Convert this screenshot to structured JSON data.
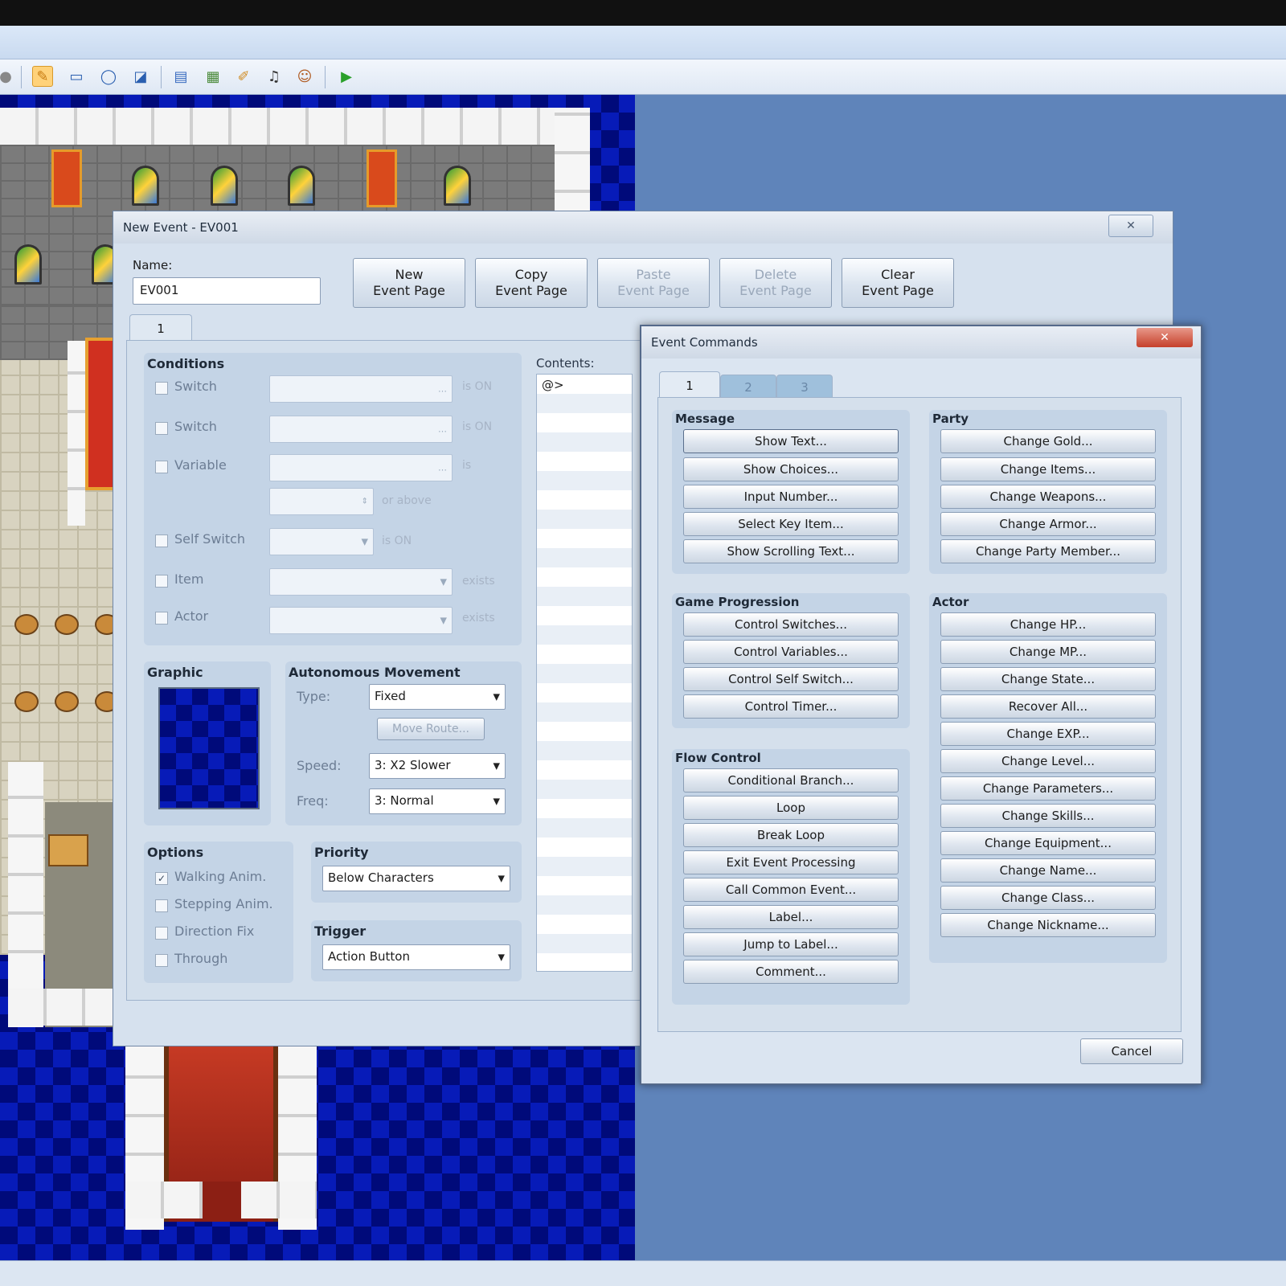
{
  "toolbar": {
    "icons": [
      "pencil-tool-icon",
      "rectangle-tool-icon",
      "ellipse-tool-icon",
      "fill-tool-icon",
      "shadow-pen-icon",
      "database-icon",
      "resource-manager-icon",
      "script-editor-icon",
      "sound-test-icon",
      "character-generator-icon",
      "playtest-icon"
    ]
  },
  "event_editor": {
    "title": "New Event - EV001",
    "close_glyph": "✕",
    "name_label": "Name:",
    "name_value": "EV001",
    "buttons": {
      "new_page_1": "New",
      "new_page_2": "Event Page",
      "copy_page_1": "Copy",
      "copy_page_2": "Event Page",
      "paste_page_1": "Paste",
      "paste_page_2": "Event Page",
      "delete_page_1": "Delete",
      "delete_page_2": "Event Page",
      "clear_page_1": "Clear",
      "clear_page_2": "Event Page"
    },
    "page_tab": "1",
    "conditions": {
      "label": "Conditions",
      "switch1": "Switch",
      "switch1_suffix": "is ON",
      "switch2": "Switch",
      "switch2_suffix": "is ON",
      "variable": "Variable",
      "variable_suffix": "is",
      "variable_above": "or above",
      "self_switch": "Self Switch",
      "self_switch_suffix": "is ON",
      "item": "Item",
      "item_suffix": "exists",
      "actor": "Actor",
      "actor_suffix": "exists"
    },
    "contents": {
      "label": "Contents:",
      "first_line": "@>"
    },
    "graphic": {
      "label": "Graphic"
    },
    "movement": {
      "label": "Autonomous Movement",
      "type_label": "Type:",
      "type_value": "Fixed",
      "move_route_button": "Move Route...",
      "speed_label": "Speed:",
      "speed_value": "3: X2 Slower",
      "freq_label": "Freq:",
      "freq_value": "3: Normal"
    },
    "options": {
      "label": "Options",
      "walking": "Walking Anim.",
      "stepping": "Stepping Anim.",
      "direction_fix": "Direction Fix",
      "through": "Through",
      "walking_checked": "✓"
    },
    "priority": {
      "label": "Priority",
      "value": "Below Characters"
    },
    "trigger": {
      "label": "Trigger",
      "value": "Action Button"
    }
  },
  "event_commands": {
    "title": "Event Commands",
    "close_glyph": "✕",
    "tabs": [
      "1",
      "2",
      "3"
    ],
    "message": {
      "label": "Message",
      "items": [
        "Show Text...",
        "Show Choices...",
        "Input Number...",
        "Select Key Item...",
        "Show Scrolling Text..."
      ]
    },
    "game_progression": {
      "label": "Game Progression",
      "items": [
        "Control Switches...",
        "Control Variables...",
        "Control Self Switch...",
        "Control Timer..."
      ]
    },
    "flow_control": {
      "label": "Flow Control",
      "items": [
        "Conditional Branch...",
        "Loop",
        "Break Loop",
        "Exit Event Processing",
        "Call Common Event...",
        "Label...",
        "Jump to Label...",
        "Comment..."
      ]
    },
    "party": {
      "label": "Party",
      "items": [
        "Change Gold...",
        "Change Items...",
        "Change Weapons...",
        "Change Armor...",
        "Change Party Member..."
      ]
    },
    "actor": {
      "label": "Actor",
      "items": [
        "Change HP...",
        "Change MP...",
        "Change State...",
        "Recover All...",
        "Change EXP...",
        "Change Level...",
        "Change Parameters...",
        "Change Skills...",
        "Change Equipment...",
        "Change Name...",
        "Change Class...",
        "Change Nickname..."
      ]
    },
    "cancel": "Cancel"
  }
}
